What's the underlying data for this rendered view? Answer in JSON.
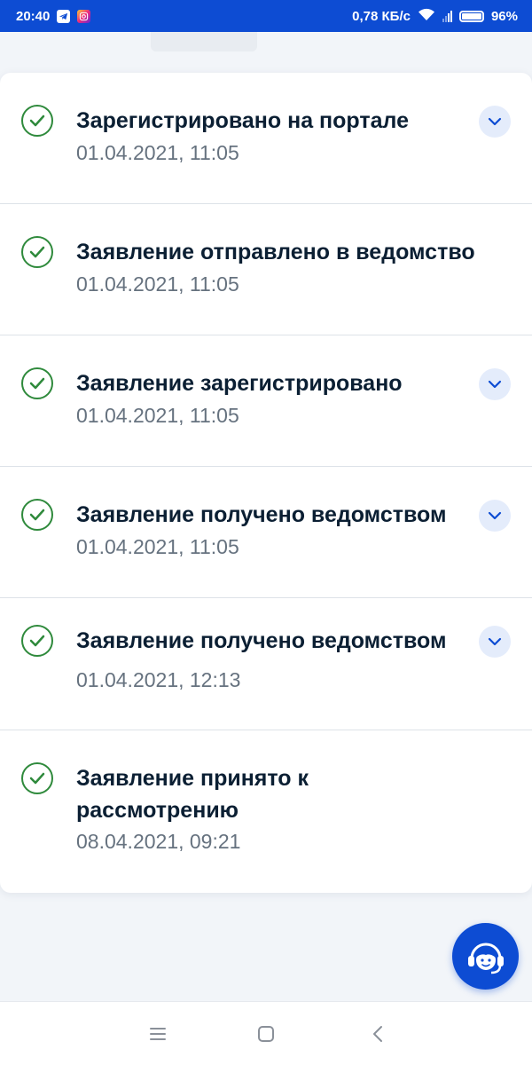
{
  "status_bar": {
    "time": "20:40",
    "network_speed": "0,78 КБ/с",
    "battery_percent": "96%",
    "battery_level": 0.96,
    "icons": [
      "telegram-icon",
      "instagram-icon",
      "wifi-icon",
      "signal-icon",
      "battery-icon"
    ]
  },
  "steps": [
    {
      "title": "Зарегистрировано на портале",
      "date": "01.04.2021, 11:05",
      "status": "done",
      "expandable": true
    },
    {
      "title": "Заявление отправлено в ведомство",
      "date": "01.04.2021, 11:05",
      "status": "done",
      "expandable": false
    },
    {
      "title": "Заявление зарегистрировано",
      "date": "01.04.2021, 11:05",
      "status": "done",
      "expandable": true
    },
    {
      "title": "Заявление получено ведомством",
      "date": "01.04.2021, 11:05",
      "status": "done",
      "expandable": true
    },
    {
      "title": "Заявление получено ведомством",
      "date": "01.04.2021, 12:13",
      "status": "done",
      "expandable": true
    },
    {
      "title": "Заявление принято к рассмотрению",
      "date": "08.04.2021, 09:21",
      "status": "done",
      "expandable": false
    }
  ],
  "support": {
    "icon": "support-agent-icon"
  },
  "nav_bar": {
    "icons": [
      "menu-icon",
      "home-icon",
      "back-icon"
    ]
  },
  "colors": {
    "brand": "#0d4cd3",
    "success": "#2f8a3c",
    "chevron_bg": "#e4ecfb",
    "text_primary": "#0b1f33",
    "text_secondary": "#66727f"
  }
}
